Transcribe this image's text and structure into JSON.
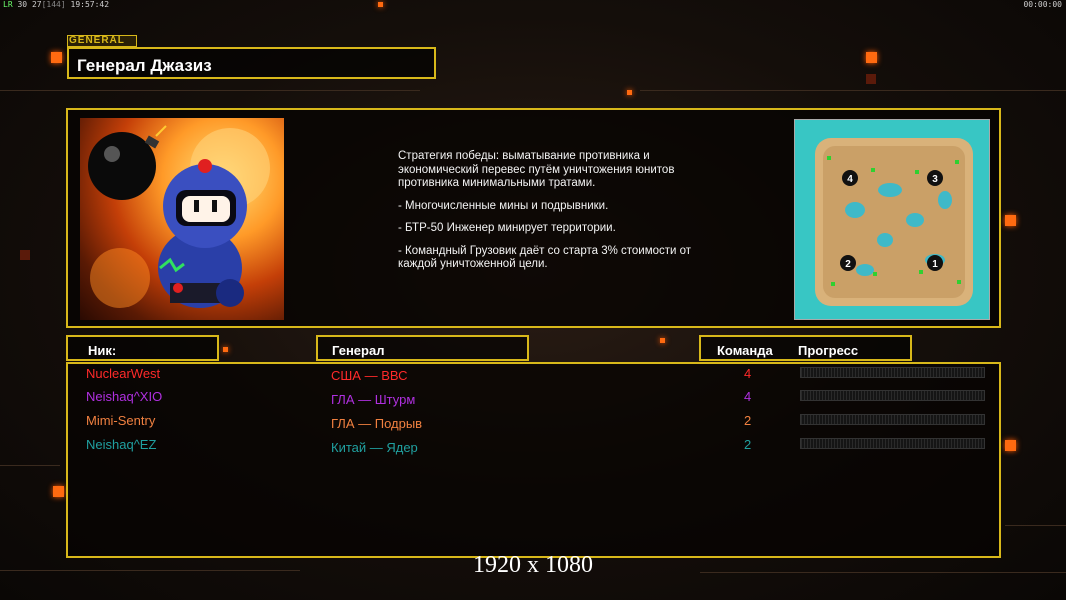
{
  "topbar": {
    "left_label": "LR",
    "fps": "30",
    "frames": "27",
    "bracket": "[144]",
    "clock": "19:57:42",
    "right_clock": "00:00:00"
  },
  "general_tag": "GENERAL",
  "general_name": "Генерал Джазиз",
  "description": [
    "Стратегия победы: выматывание противника и экономический перевес путём уничтожения юнитов противника минимальными тратами.",
    "- Многочисленные мины и подрывники.",
    "- БТР-50 Инженер минирует территории.",
    "- Командный Грузовик даёт со старта 3% стоимости от каждой уничтоженной цели."
  ],
  "map_labels": [
    "4",
    "3",
    "2",
    "1"
  ],
  "headers": {
    "nick": "Ник:",
    "general": "Генерал",
    "team": "Команда",
    "progress": "Прогресс"
  },
  "players": [
    {
      "nick": "NuclearWest",
      "general": "США — ВВС",
      "team": "4",
      "color": "#ff2a2a"
    },
    {
      "nick": "Neishaq^XIO",
      "general": "ГЛА — Штурм",
      "team": "4",
      "color": "#b030e0"
    },
    {
      "nick": "Mimi-Sentry",
      "general": "ГЛА — Подрыв",
      "team": "2",
      "color": "#f08040"
    },
    {
      "nick": "Neishaq^EZ",
      "general": "Китай — Ядер",
      "team": "2",
      "color": "#20a0a0"
    }
  ],
  "resolution": "1920 x 1080",
  "colors": {
    "accent": "#d8b81a",
    "highlight": "#ff6a10"
  }
}
